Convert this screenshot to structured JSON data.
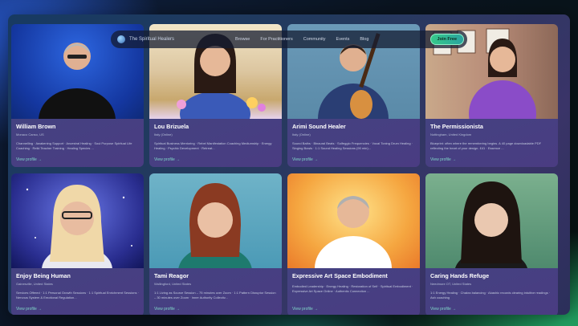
{
  "nav": {
    "brand": "The Spiritual Healers",
    "links": [
      "Browse",
      "For Practitioners",
      "Community",
      "Events",
      "Blog"
    ],
    "join": "Join Free"
  },
  "cards": [
    {
      "name": "William Brown",
      "location": "Monaco Canso, US",
      "tags": "Channelling · Awakening Support · Ancestral Healing · Soul Purpose Spiritual Life Coaching · Reiki Teacher Training · Healing Species ...",
      "view": "View profile →"
    },
    {
      "name": "Lou Brizuela",
      "location": "Italy (Online)",
      "tags": "Spiritual Business Mentoring · Rebel Manifestation Coaching Mediumship · Energy Healing · Psychic Development · Retreat...",
      "view": "View profile →"
    },
    {
      "name": "Arimi Sound Healer",
      "location": "Italy (Online)",
      "tags": "Sound Baths · Binaural Beats · Solfeggio Frequencies · Vocal Toning Drum Healing · Singing Bowls · 1:1 Sound Healing Sessions (90 min)...",
      "view": "View profile →"
    },
    {
      "name": "The Permissionista",
      "location": "Nottingham, United Kingdom",
      "tags": "Blueprint: often where the remembering begins. A 40 page downloadable PDF reflecting the heart of your design. £41 · Essence ...",
      "view": "View profile →"
    },
    {
      "name": "Enjoy Being Human",
      "location": "Gainesville, United States",
      "tags": "Services Offered · 1:1 Personal Growth Sessions · 1:1 Spiritual Enrichment Sessions · Nervous System & Emotional Regulation...",
      "view": "View profile →"
    },
    {
      "name": "Tami Reagor",
      "location": "Wallingford, United States",
      "tags": "1:1 Living as Source Session – 75 minutes over Zoom · 1:1 Pattern Disruptor Session – 30 minutes over Zoom · Inner Authority Collectiv...",
      "view": "View profile →"
    },
    {
      "name": "Expressive Art Space Embodiment",
      "location": "",
      "tags": "Embodied Leadership · Energy Healing · Restoration of Self · Spiritual Embodiment · Expressive Art Space Online · Authentic Connection ...",
      "view": "View profile →"
    },
    {
      "name": "Caring Hands Refuge",
      "location": "Needmore OT, United States",
      "tags": "1:1 Energy Healing · Chakra balancing · Akashic records clearing intuitive readings · Ash coaching",
      "view": "View profile →"
    }
  ]
}
